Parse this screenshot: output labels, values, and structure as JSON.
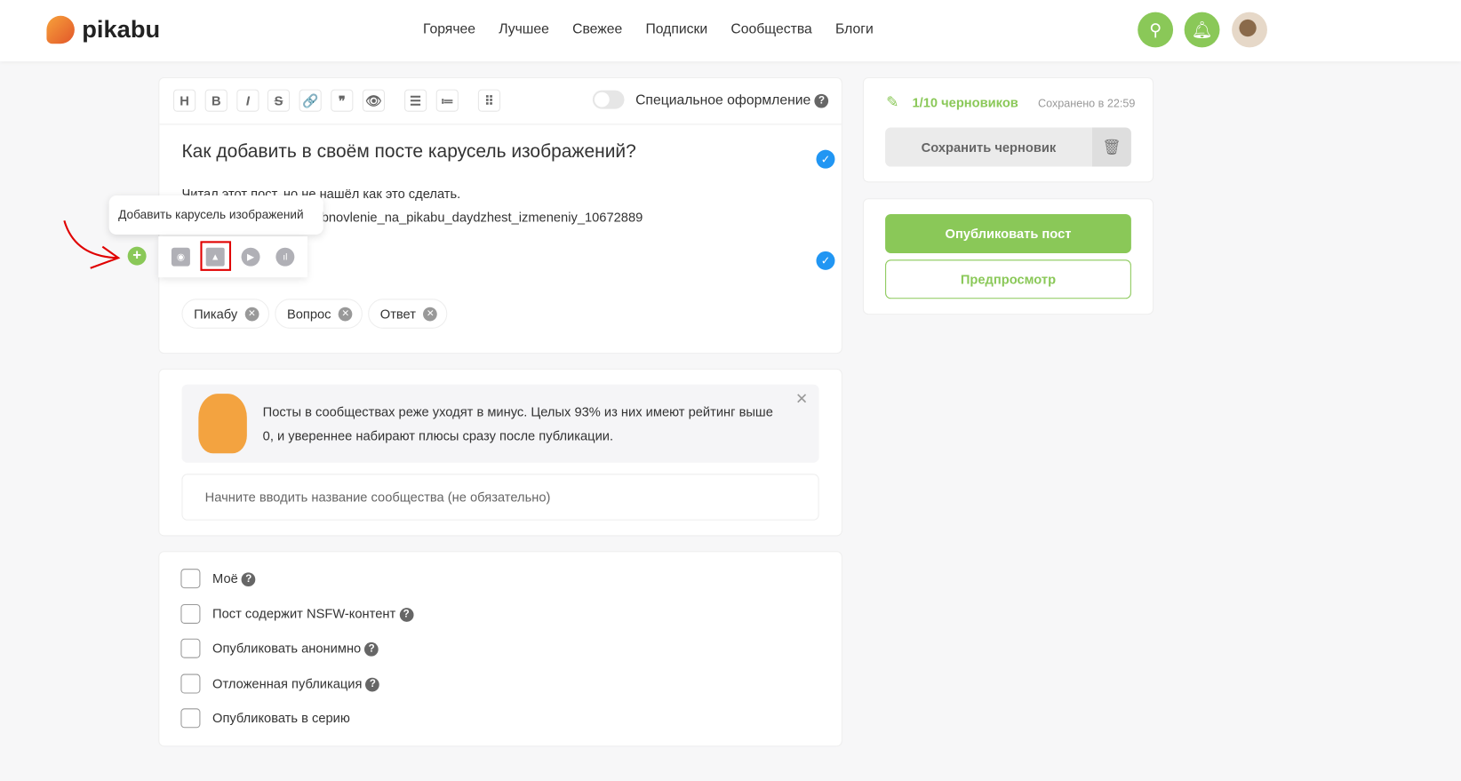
{
  "header": {
    "logo": "pikabu",
    "nav": [
      "Горячее",
      "Лучшее",
      "Свежее",
      "Подписки",
      "Сообщества",
      "Блоги"
    ]
  },
  "editor": {
    "toolbar": [
      "H",
      "B",
      "I",
      "S",
      "🔗",
      "❞",
      "👁",
      "☰",
      "≔",
      "⠿"
    ],
    "special_label": "Специальное оформление",
    "title": "Как добавить в своём посте  карусель изображений?",
    "line1": "Читал этот пост, но не нашёл как это сделать.",
    "line2": "bnovlenie_na_pikabu_daydzhest_izmeneniy_10672889",
    "tooltip": "Добавить карусель изображений",
    "tags": [
      "Пикабу",
      "Вопрос",
      "Ответ"
    ]
  },
  "community": {
    "tip": "Посты в сообществах реже уходят в минус. Целых 93% из них имеют рейтинг выше 0, и увереннее набирают плюсы сразу после публикации.",
    "placeholder": "Начните вводить название сообщества (не обязательно)"
  },
  "options": [
    {
      "label": "Моё",
      "help": true
    },
    {
      "label": "Пост содержит NSFW-контент",
      "help": true
    },
    {
      "label": "Опубликовать анонимно",
      "help": true
    },
    {
      "label": "Отложенная публикация",
      "help": true
    },
    {
      "label": "Опубликовать в серию",
      "help": false
    }
  ],
  "sidebar": {
    "drafts": "1/10 черновиков",
    "saved": "Сохранено в 22:59",
    "save_draft": "Сохранить черновик",
    "publish": "Опубликовать пост",
    "preview": "Предпросмотр"
  },
  "colors": {
    "accent": "#8ac858",
    "check": "#2196f3",
    "highlight": "#e00000"
  }
}
